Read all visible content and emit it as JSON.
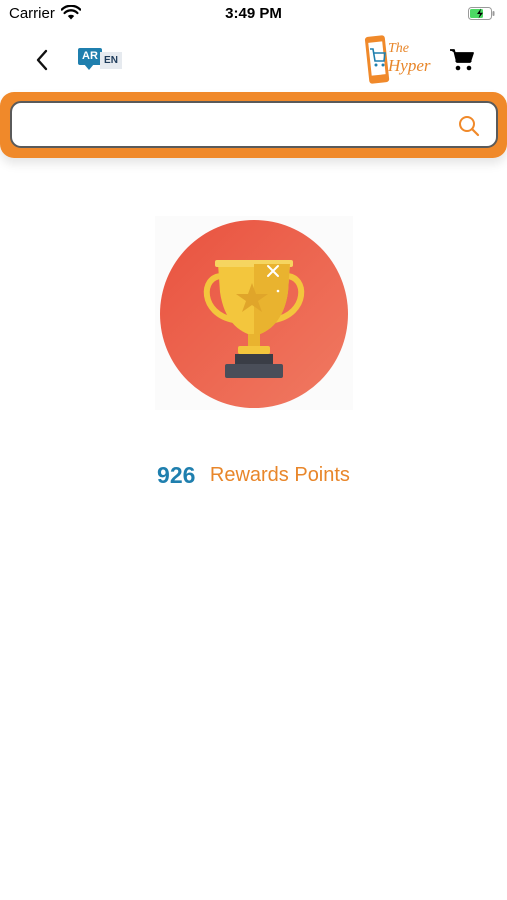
{
  "status_bar": {
    "carrier": "Carrier",
    "time": "3:49 PM"
  },
  "header": {
    "language": {
      "ar": "AR",
      "en": "EN"
    },
    "logo": {
      "line1": "The",
      "line2": "Hyper"
    }
  },
  "search": {
    "value": "",
    "placeholder": ""
  },
  "rewards": {
    "points": "926",
    "label": "Rewards Points"
  },
  "colors": {
    "brand_orange": "#f0892a",
    "brand_blue": "#1f7fae",
    "trophy_circle": "#ec6553",
    "trophy_gold": "#f3c63d"
  },
  "icons": {
    "back": "chevron-left-icon",
    "cart": "shopping-cart-icon",
    "search": "magnifier-icon",
    "trophy": "trophy-icon"
  }
}
